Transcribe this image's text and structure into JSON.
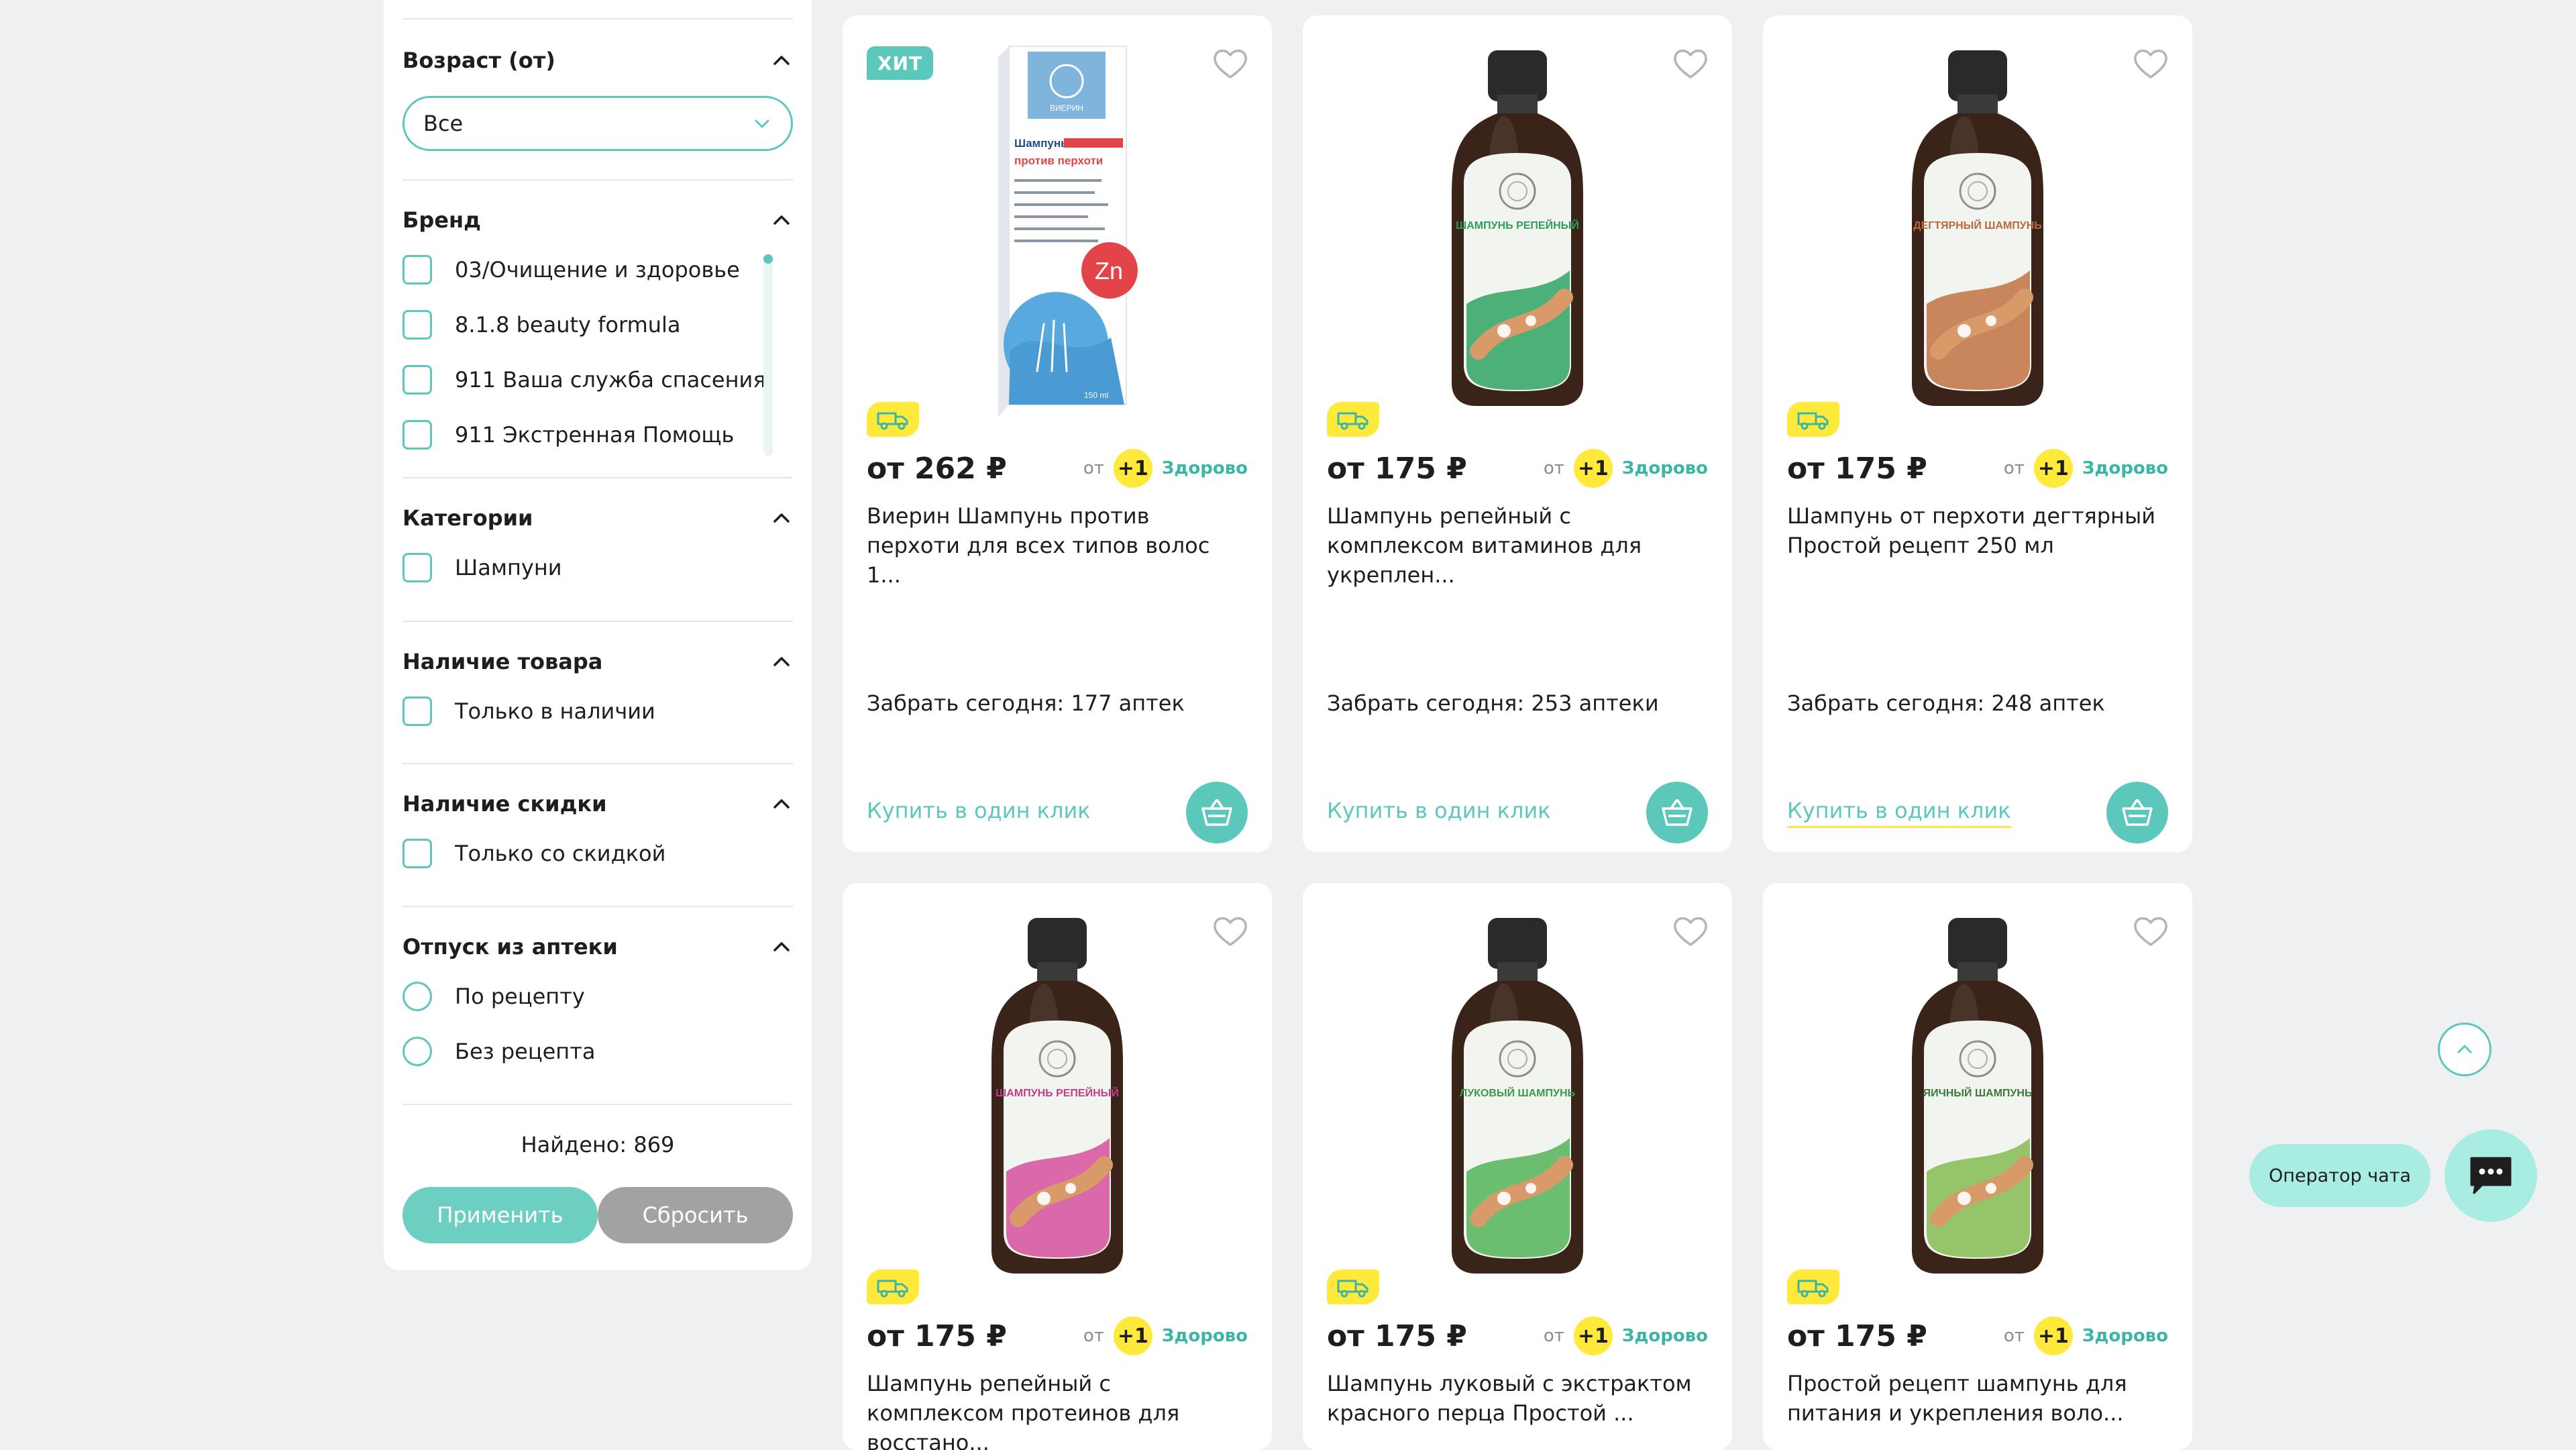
{
  "filters": {
    "age": {
      "title": "Возраст (от)",
      "selected": "Все"
    },
    "brand": {
      "title": "Бренд",
      "items": [
        "03/Очищение и здоровье",
        "8.1.8 beauty formula",
        "911 Ваша служба спасения",
        "911 Экстренная Помощь"
      ]
    },
    "category": {
      "title": "Категории",
      "items": [
        "Шампуни"
      ]
    },
    "stock": {
      "title": "Наличие товара",
      "items": [
        "Только в наличии"
      ]
    },
    "discount": {
      "title": "Наличие скидки",
      "items": [
        "Только со скидкой"
      ]
    },
    "prescription": {
      "title": "Отпуск из аптеки",
      "items": [
        "По рецепту",
        "Без рецепта"
      ]
    },
    "found": "Найдено: 869",
    "apply_label": "Применить",
    "reset_label": "Сбросить"
  },
  "bonus": {
    "from": "от",
    "value": "+1",
    "brand": "Здорово"
  },
  "buy_label": "Купить в один клик",
  "products": [
    {
      "badge": "ХИТ",
      "price": "от 262 ₽",
      "title": "Виерин Шампунь против перхоти для всех типов волос 1...",
      "pickup": "Забрать сегодня: 177 аптек",
      "box_brand": "ВИЕРИН",
      "box_line1": "Шампунь",
      "box_line2": "против перхоти",
      "box_zn": "Zn",
      "box_volume": "150 ml"
    },
    {
      "price": "от 175 ₽",
      "title": "Шампунь репейный с комплексом витаминов для укреплен...",
      "pickup": "Забрать сегодня: 253 аптеки",
      "label_text": "ШАМПУНЬ РЕПЕЙНЫЙ",
      "label_color": "#2e9e5e",
      "accent": "#3aa86a"
    },
    {
      "price": "от 175 ₽",
      "title": "Шампунь от перхоти дегтярный Простой рецепт 250 мл",
      "pickup": "Забрать сегодня: 248 аптек",
      "label_text": "ДЕГТЯРНЫЙ ШАМПУНЬ",
      "label_color": "#b86a3c",
      "accent": "#c47a4c"
    },
    {
      "price": "от 175 ₽",
      "title": "Шампунь репейный с комплексом протеинов для восстано...",
      "label_text": "ШАМПУНЬ РЕПЕЙНЫЙ",
      "label_color": "#c23d8a",
      "accent": "#d65aa0"
    },
    {
      "price": "от 175 ₽",
      "title": "Шампунь луковый с экстрактом красного перца Простой ...",
      "label_text": "ЛУКОВЫЙ ШАМПУНЬ",
      "label_color": "#3e9a4a",
      "accent": "#5cb860"
    },
    {
      "price": "от 175 ₽",
      "title": "Простой рецепт шампунь для питания и укрепления воло...",
      "label_text": "ЯИЧНЫЙ ШАМПУНЬ",
      "label_color": "#3c7a3c",
      "accent": "#8cc05a"
    }
  ],
  "chat": {
    "operator_label": "Оператор чата"
  }
}
